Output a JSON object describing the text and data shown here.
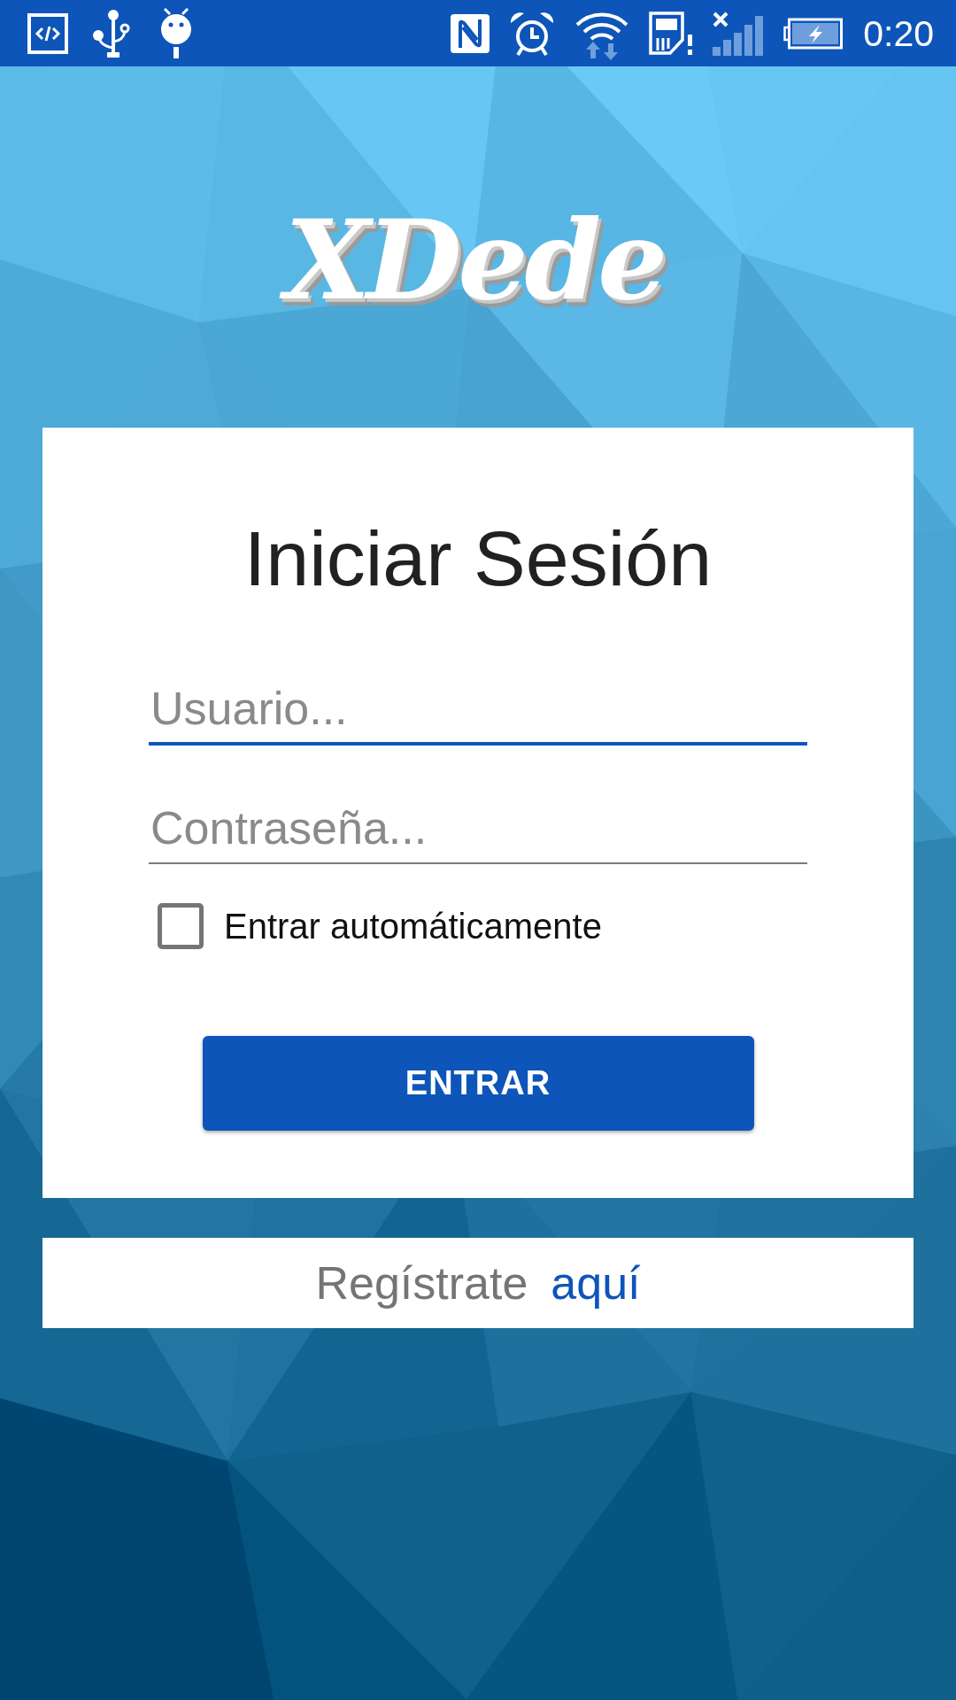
{
  "status_bar": {
    "time": "0:20"
  },
  "logo": {
    "text": "XDede"
  },
  "login_card": {
    "title": "Iniciar Sesión",
    "fields": [
      {
        "placeholder": "Usuario...",
        "focused": true
      },
      {
        "placeholder": "Contraseña...",
        "focused": false
      }
    ],
    "auto_login": {
      "label": "Entrar automáticamente",
      "checked": false
    },
    "submit_button": "ENTRAR"
  },
  "register_bar": {
    "text": "Regístrate",
    "link": "aquí"
  }
}
